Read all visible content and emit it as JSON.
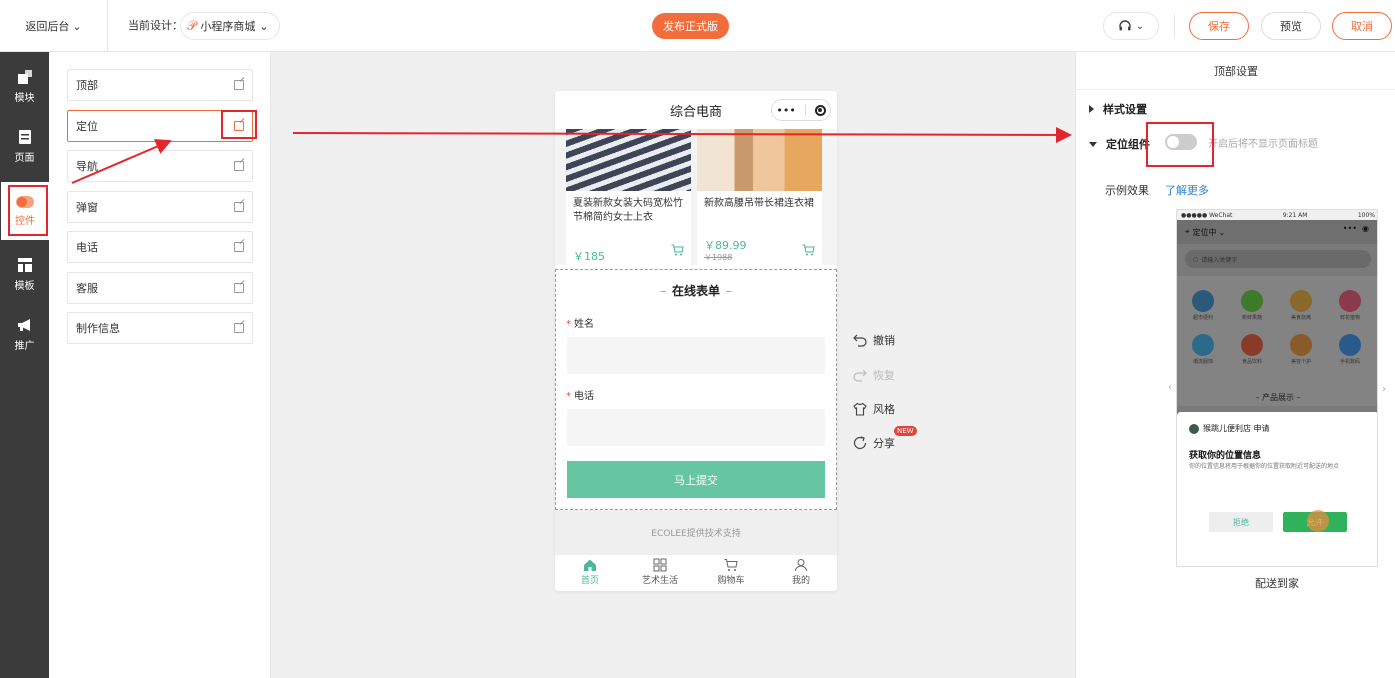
{
  "topbar": {
    "back_label": "返回后台",
    "current_design_label": "当前设计：",
    "design_name": "小程序商城",
    "publish_label": "发布正式版",
    "save_label": "保存",
    "preview_label": "预览",
    "cancel_label": "取消"
  },
  "sidebar": {
    "items": [
      {
        "label": "模块",
        "icon": "module-icon"
      },
      {
        "label": "页面",
        "icon": "page-icon"
      },
      {
        "label": "控件",
        "icon": "toggle-icon"
      },
      {
        "label": "模板",
        "icon": "template-icon"
      },
      {
        "label": "推广",
        "icon": "megaphone-icon"
      }
    ],
    "active_index": 2
  },
  "components": {
    "items": [
      "顶部",
      "定位",
      "导航",
      "弹窗",
      "电话",
      "客服",
      "制作信息"
    ],
    "active_index": 1
  },
  "phone": {
    "title": "综合电商",
    "capsule_dots": "•••",
    "products": [
      {
        "name": "夏装新款女装大码宽松竹节棉简约女士上衣",
        "price": "￥185"
      },
      {
        "name": "新款高腰吊带长裙连衣裙",
        "price": "￥89.99",
        "original_price": "￥1988"
      }
    ],
    "form": {
      "title": "在线表单",
      "title_dash": "–",
      "required_mark": "*",
      "fields": [
        {
          "label": "姓名"
        },
        {
          "label": "电话"
        }
      ],
      "submit_label": "马上提交"
    },
    "footer_text": "ECOLEE提供技术支持",
    "tabs": [
      {
        "label": "首页",
        "icon": "home-icon"
      },
      {
        "label": "艺术生活",
        "icon": "grid-icon"
      },
      {
        "label": "购物车",
        "icon": "cart-icon"
      },
      {
        "label": "我的",
        "icon": "user-icon"
      }
    ]
  },
  "actions": {
    "undo": "撤销",
    "redo": "恢复",
    "style": "风格",
    "share": "分享",
    "new_badge": "NEW"
  },
  "settings": {
    "title": "顶部设置",
    "style_section": "样式设置",
    "location_label": "定位组件",
    "location_hint": "开启后将不显示页面标题",
    "location_enabled": false,
    "example_label": "示例效果",
    "learn_more": "了解更多",
    "mock": {
      "status_carrier": "●●●●● WeChat",
      "status_time": "9:21 AM",
      "status_battery": "100%",
      "location_text": "定位中",
      "search_placeholder": "请输入关键字",
      "grid": [
        "超市便利",
        "新鲜果蔬",
        "美食烧烤",
        "鲜花植物",
        "潮流服饰",
        "食品饮料",
        "美容个护",
        "手机数码"
      ],
      "section_title": "– 产品展示 –",
      "shop_request": "猴跳儿便利店 申请",
      "dialog_title": "获取你的位置信息",
      "dialog_desc": "你的位置信息将用于根据你的位置获取附近可配送的地点",
      "reject": "拒绝",
      "allow": "允许"
    },
    "caption": "配送到家"
  },
  "colors": {
    "accent": "#f26d3c",
    "green": "#4bb898",
    "annotation": "#e3262e"
  }
}
